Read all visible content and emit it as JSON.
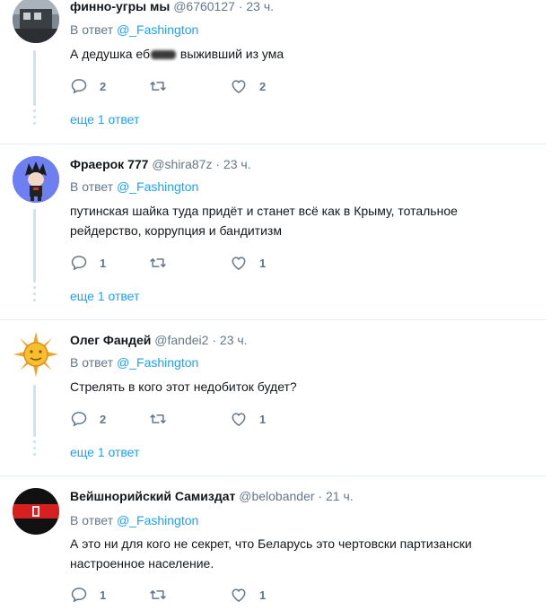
{
  "tweets": [
    {
      "name": "финно-угры мы",
      "handle": "@6760127",
      "time": "23 ч.",
      "reply_prefix": "В ответ",
      "reply_to": "@_Fashington",
      "text_before": "А дедушка еб",
      "text_after": " выживший из ума",
      "replies": "2",
      "retweets": "",
      "likes": "2",
      "more": "еще 1 ответ"
    },
    {
      "name": "Фраерок 777",
      "handle": "@shira87z",
      "time": "23 ч.",
      "reply_prefix": "В ответ",
      "reply_to": "@_Fashington",
      "text_line1": "путинская шайка туда придёт и станет всё как в Крыму, тотальное",
      "text_line2": "рейдерство, коррупция и бандитизм",
      "replies": "1",
      "retweets": "",
      "likes": "1",
      "more": "еще 1 ответ"
    },
    {
      "name": "Олег Фандей",
      "handle": "@fandei2",
      "time": "23 ч.",
      "reply_prefix": "В ответ",
      "reply_to": "@_Fashington",
      "text": "Стрелять в кого этот недобиток будет?",
      "replies": "2",
      "retweets": "",
      "likes": "1",
      "more": "еще 1 ответ"
    },
    {
      "name": "Вейшнорийский Самиздат",
      "handle": "@belobander",
      "time": "21 ч.",
      "reply_prefix": "В ответ",
      "reply_to": "@_Fashington",
      "text_line1": "А это ни для кого не секрет, что Беларусь это чертовски партизански",
      "text_line2": "настроенное население.",
      "replies": "1",
      "retweets": "",
      "likes": "1"
    }
  ],
  "icons": {
    "reply": "reply-icon",
    "retweet": "retweet-icon",
    "like": "like-icon"
  },
  "colors": {
    "link": "#1da1f2",
    "muted": "#657786",
    "thread_line": "#cce3f2",
    "separator": "#e6ecf0"
  }
}
